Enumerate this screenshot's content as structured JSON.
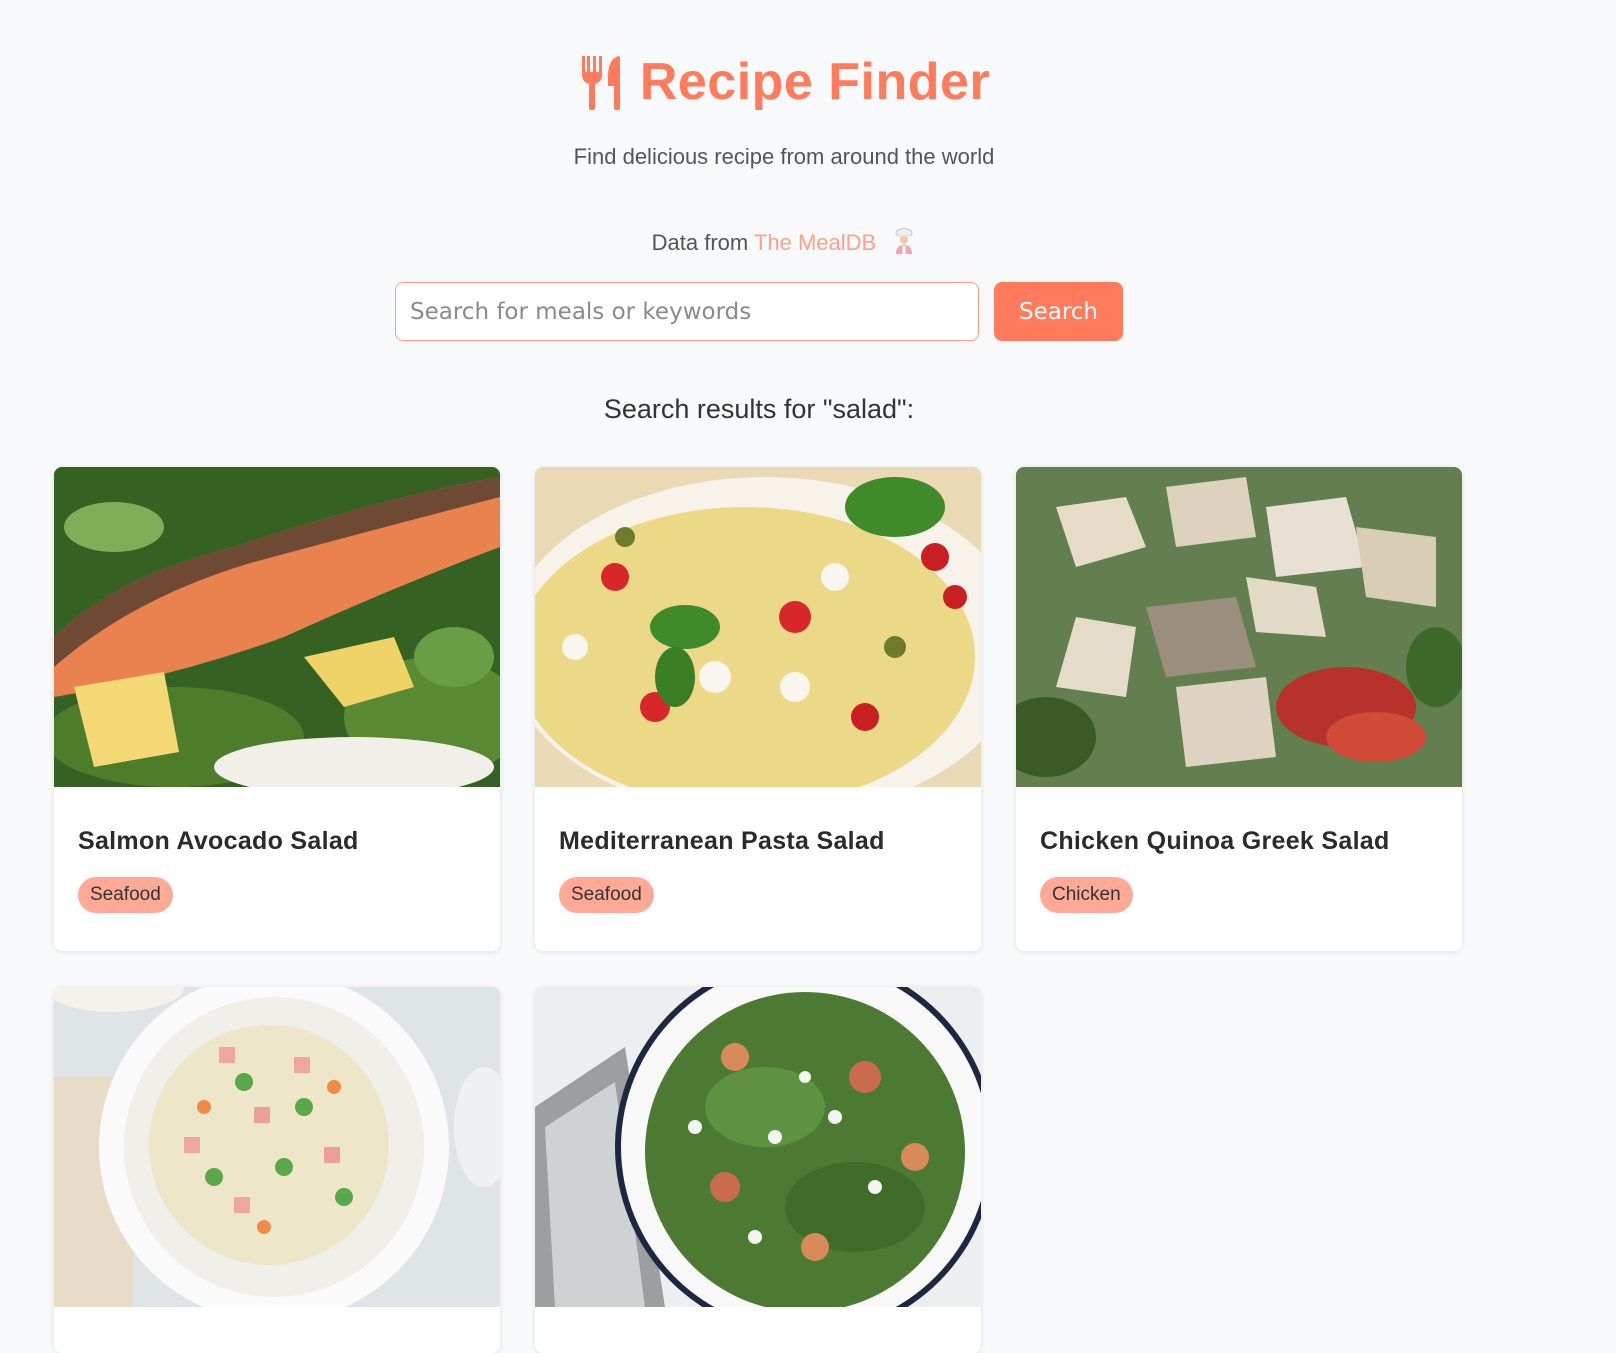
{
  "header": {
    "title": "Recipe Finder",
    "subtitle": "Find delicious recipe from around the world",
    "data_from_prefix": "Data from ",
    "data_source": "The MealDB",
    "logo_icon": "fork-knife-icon",
    "chef_icon": "chef-icon"
  },
  "search": {
    "placeholder": "Search for meals or keywords",
    "value": "",
    "button_label": "Search"
  },
  "results": {
    "heading": "Search results for \"salad\":",
    "meals": [
      {
        "name": "Salmon Avocado Salad",
        "category": "Seafood"
      },
      {
        "name": "Mediterranean Pasta Salad",
        "category": "Seafood"
      },
      {
        "name": "Chicken Quinoa Greek Salad",
        "category": "Chicken"
      },
      {
        "name": "",
        "category": ""
      },
      {
        "name": "",
        "category": ""
      }
    ]
  },
  "colors": {
    "accent": "#ff7b5c",
    "tag_bg": "#ffa996",
    "page_bg": "#f8f9fa"
  }
}
